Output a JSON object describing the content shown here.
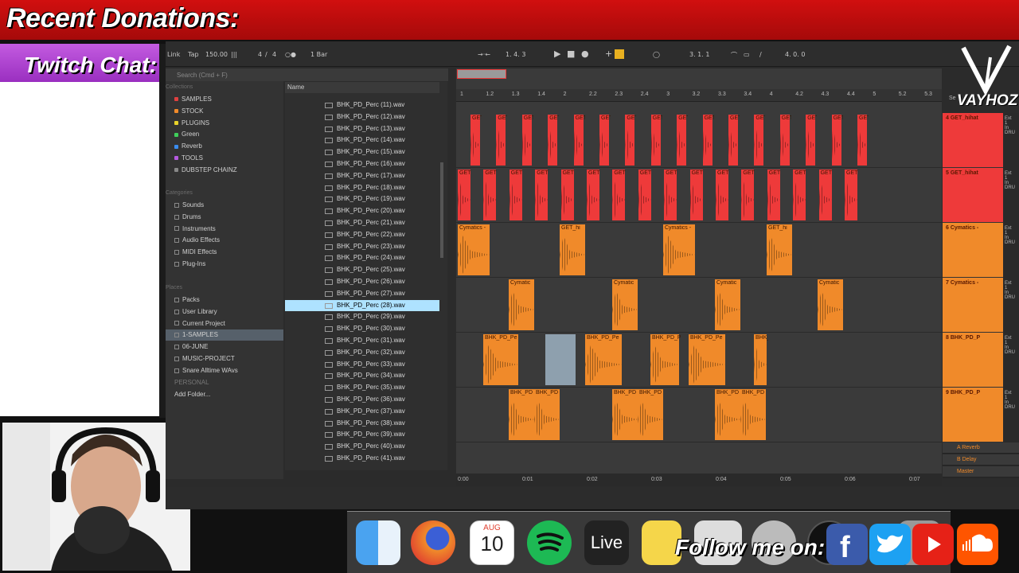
{
  "overlay": {
    "banner_title": "Recent Donations:",
    "chat_title": "Twitch Chat:",
    "follow_text": "Follow me on:",
    "logo_text": "VAYHOZ",
    "colors": {
      "banner": "#d10f0f",
      "chat_header": "#b247d8"
    }
  },
  "transport": {
    "link": "Link",
    "tap": "Tap",
    "tempo": "150.00",
    "time_sig_num": "4",
    "time_sig_den": "4",
    "quantize": "1 Bar",
    "position": "1.  4.  3",
    "loop_start": "3.  1.  1",
    "loop_length": "4.  0.  0"
  },
  "browser": {
    "search_placeholder": "Search (Cmd + F)",
    "collections_heading": "Collections",
    "collections": [
      {
        "label": "SAMPLES",
        "color": "#e04040"
      },
      {
        "label": "STOCK",
        "color": "#f08a2a"
      },
      {
        "label": "PLUGINS",
        "color": "#e8d22a"
      },
      {
        "label": "Green",
        "color": "#3fcf5a"
      },
      {
        "label": "Reverb",
        "color": "#3a8df0"
      },
      {
        "label": "TOOLS",
        "color": "#b55ae0"
      },
      {
        "label": "DUBSTEP CHAINZ",
        "color": "#888888"
      }
    ],
    "categories_heading": "Categories",
    "categories": [
      "Sounds",
      "Drums",
      "Instruments",
      "Audio Effects",
      "MIDI Effects",
      "Plug-Ins"
    ],
    "places_heading": "Places",
    "places": [
      "Packs",
      "User Library",
      "Current Project",
      "1-SAMPLES",
      "06-JUNE",
      "MUSIC-PROJECT",
      "Snare Alltime WAvs"
    ],
    "personal": "PERSONAL",
    "add_folder": "Add Folder...",
    "name_header": "Name",
    "files": [
      "BHK_PD_Perc (11).wav",
      "BHK_PD_Perc (12).wav",
      "BHK_PD_Perc (13).wav",
      "BHK_PD_Perc (14).wav",
      "BHK_PD_Perc (15).wav",
      "BHK_PD_Perc (16).wav",
      "BHK_PD_Perc (17).wav",
      "BHK_PD_Perc (18).wav",
      "BHK_PD_Perc (19).wav",
      "BHK_PD_Perc (20).wav",
      "BHK_PD_Perc (21).wav",
      "BHK_PD_Perc (22).wav",
      "BHK_PD_Perc (23).wav",
      "BHK_PD_Perc (24).wav",
      "BHK_PD_Perc (25).wav",
      "BHK_PD_Perc (26).wav",
      "BHK_PD_Perc (27).wav",
      "BHK_PD_Perc (28).wav",
      "BHK_PD_Perc (29).wav",
      "BHK_PD_Perc (30).wav",
      "BHK_PD_Perc (31).wav",
      "BHK_PD_Perc (32).wav",
      "BHK_PD_Perc (33).wav",
      "BHK_PD_Perc (34).wav",
      "BHK_PD_Perc (35).wav",
      "BHK_PD_Perc (36).wav",
      "BHK_PD_Perc (37).wav",
      "BHK_PD_Perc (38).wav",
      "BHK_PD_Perc (39).wav",
      "BHK_PD_Perc (40).wav",
      "BHK_PD_Perc (41).wav"
    ],
    "selected_file": "BHK_PD_Perc (28).wav"
  },
  "ruler": [
    "1",
    "1.2",
    "1.3",
    "1.4",
    "2",
    "2.2",
    "2.3",
    "2.4",
    "3",
    "3.2",
    "3.3",
    "3.4",
    "4",
    "4.2",
    "4.3",
    "4.4",
    "5",
    "5.2",
    "5.3"
  ],
  "timeline": [
    "0:00",
    "0:01",
    "0:02",
    "0:03",
    "0:04",
    "0:05",
    "0:06",
    "0:07"
  ],
  "tracks": [
    {
      "name": "4 GET_hihat",
      "color": "#ee3a3a"
    },
    {
      "name": "5 GET_hihat",
      "color": "#ee3a3a"
    },
    {
      "name": "6 Cymatics -",
      "color": "#f08a2a"
    },
    {
      "name": "7 Cymatics -",
      "color": "#f08a2a"
    },
    {
      "name": "8 BHK_PD_P",
      "color": "#f08a2a"
    },
    {
      "name": "9 BHK_PD_P",
      "color": "#f08a2a"
    }
  ],
  "returns": [
    "A Reverb",
    "B Delay",
    "Master"
  ],
  "clip_labels": {
    "hihat": "GET",
    "cym": "Cymatics -",
    "get_hi": "GET_hi",
    "cym7": "Cymatic",
    "bhk": "BHK_PD_Pe",
    "bhk2": "BHK_PD"
  },
  "dock": {
    "calendar_month": "AUG",
    "calendar_day": "10",
    "live": "Live"
  }
}
